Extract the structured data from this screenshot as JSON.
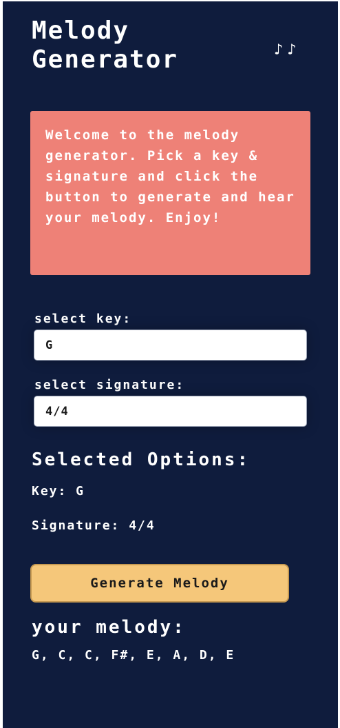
{
  "header": {
    "title": "Melody\nGenerator",
    "notes_glyph": "♪♪"
  },
  "welcome": {
    "text": "Welcome to the melody generator. Pick a key & signature and click the button to generate and hear your melody. Enjoy!"
  },
  "form": {
    "key_label": "select key:",
    "key_value": "G",
    "signature_label": "select signature:",
    "signature_value": "4/4"
  },
  "selected": {
    "title": "Selected Options:",
    "key_line": "Key: G",
    "signature_line": "Signature: 4/4"
  },
  "actions": {
    "generate_label": "Generate Melody"
  },
  "melody": {
    "title": "your melody:",
    "notes": "G, C, C, F#, E, A, D, E"
  },
  "colors": {
    "background": "#0f1c3d",
    "welcome_panel": "#ee8177",
    "button": "#f5c77a"
  }
}
